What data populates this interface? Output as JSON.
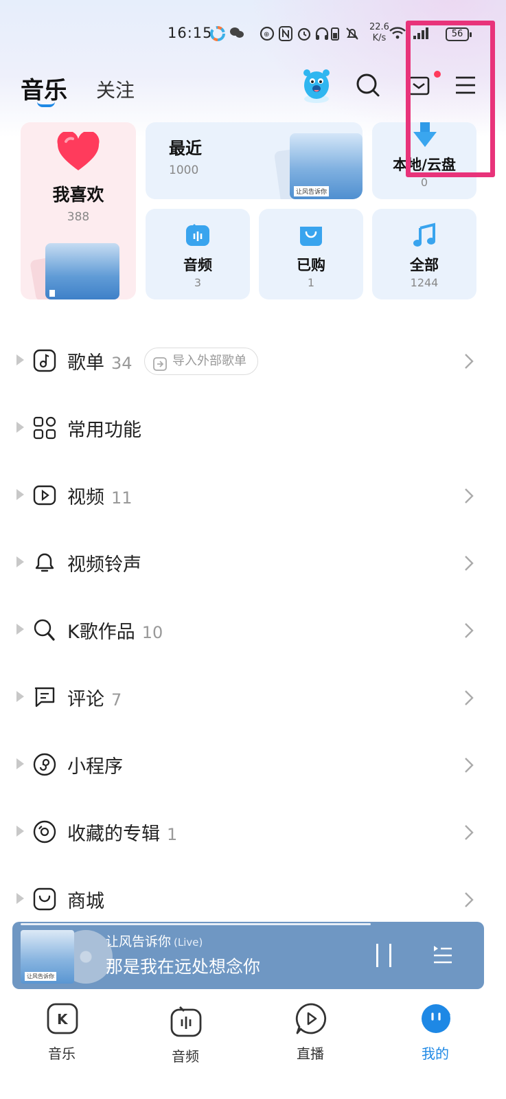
{
  "status_bar": {
    "time": "16:15",
    "net_speed_value": "22.6",
    "net_speed_unit": "K/s",
    "battery": "56"
  },
  "header": {
    "tabs": [
      {
        "label": "音乐",
        "active": true
      },
      {
        "label": "关注",
        "active": false
      }
    ],
    "icons": [
      "mascot-icon",
      "search-icon",
      "mail-icon",
      "menu-icon"
    ]
  },
  "cards": {
    "favorites": {
      "title": "我喜欢",
      "count": "388"
    },
    "recent": {
      "title": "最近",
      "count": "1000",
      "thumb_caption": "让风告诉你"
    },
    "local": {
      "title": "本地/云盘",
      "count": "0"
    },
    "audio": {
      "title": "音频",
      "count": "3"
    },
    "purchased": {
      "title": "已购",
      "count": "1"
    },
    "all": {
      "title": "全部",
      "count": "1244"
    }
  },
  "list": [
    {
      "label": "歌单",
      "count": "34",
      "extra_button": "导入外部歌单",
      "icon": "note-icon"
    },
    {
      "label": "常用功能",
      "count": "",
      "icon": "grid-icon"
    },
    {
      "label": "视频",
      "count": "11",
      "icon": "video-icon"
    },
    {
      "label": "视频铃声",
      "count": "",
      "icon": "bell-icon"
    },
    {
      "label": "K歌作品",
      "count": "10",
      "icon": "karaoke-icon"
    },
    {
      "label": "评论",
      "count": "7",
      "icon": "comment-icon"
    },
    {
      "label": "小程序",
      "count": "",
      "icon": "miniprogram-icon"
    },
    {
      "label": "收藏的专辑",
      "count": "1",
      "icon": "album-icon"
    },
    {
      "label": "商城",
      "count": "",
      "icon": "bag-icon"
    }
  ],
  "player": {
    "song": "让风告诉你",
    "tag": "(Live)",
    "lyric": "那是我在远处想念你",
    "cover_caption": "让风告诉你"
  },
  "bottom_nav": [
    {
      "label": "音乐",
      "icon": "k-icon"
    },
    {
      "label": "音频",
      "icon": "radio-icon"
    },
    {
      "label": "直播",
      "icon": "play-bubble-icon"
    },
    {
      "label": "我的",
      "icon": "mine-icon",
      "active": true
    }
  ],
  "colors": {
    "accent": "#1e88e5",
    "highlight_box": "#e8337a",
    "heart": "#ff3b5c",
    "player_bg": "#6f97c3"
  }
}
